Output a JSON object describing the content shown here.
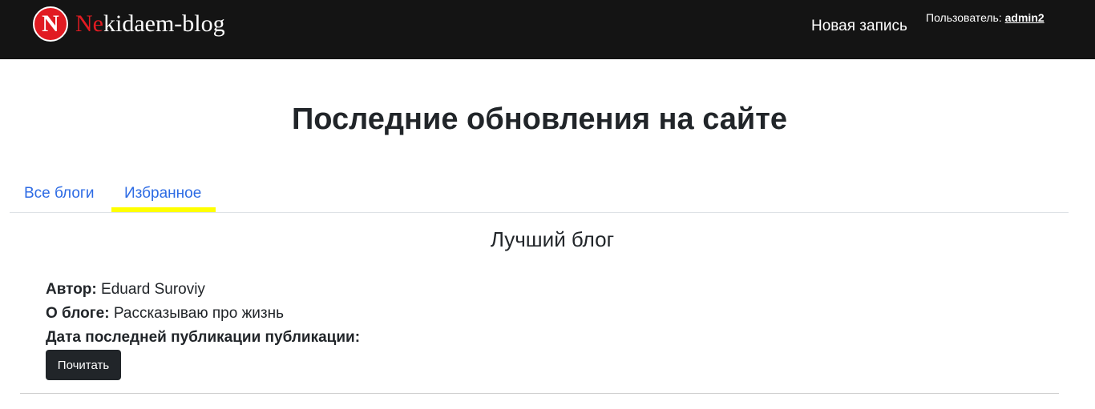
{
  "header": {
    "logo_letter": "N",
    "brand_accent": "Ne",
    "brand_rest": "kidaem-blog",
    "new_post_label": "Новая запись",
    "user_prefix": "Пользователь:",
    "username": "admin2"
  },
  "main": {
    "title": "Последние обновления на сайте",
    "tabs": [
      {
        "label": "Все блоги"
      },
      {
        "label": "Избранное",
        "highlighted": true
      }
    ]
  },
  "blog_card": {
    "title": "Лучший блог",
    "author_label": "Автор:",
    "author_value": "Eduard Suroviy",
    "about_label": "О блоге:",
    "about_value": "Рассказываю про жизнь",
    "date_label": "Дата последней публикации публикации:",
    "date_value": "",
    "read_button_label": "Почитать"
  },
  "colors": {
    "navbar_bg": "#141414",
    "brand_red": "#e11b22",
    "link_blue": "#2d6be4",
    "highlight_yellow": "#ffff00",
    "button_dark": "#212529"
  },
  "icons": {
    "logo": "red-circle-N-logo"
  }
}
